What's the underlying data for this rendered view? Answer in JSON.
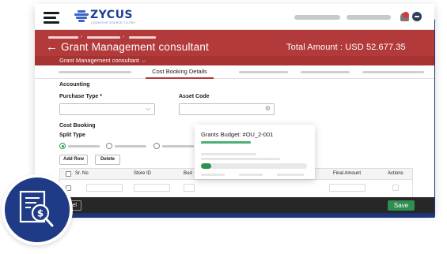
{
  "header": {
    "brand": "ZYCUS",
    "brand_tagline": "COGNITIVE SOURCE-TO-PAY"
  },
  "page": {
    "title": "Grant Management consultant",
    "total_amount": "Total Amount : USD 52.677.35",
    "subtitle": "Grant Management consultant",
    "active_tab": "Cost Booking Details"
  },
  "form": {
    "accounting_label": "Accounting",
    "purchase_type_label": "Purchase Type *",
    "purchase_type_value": "",
    "asset_code_label": "Asset Code",
    "asset_code_value": "",
    "cost_booking_label": "Cost Booking",
    "split_type_label": "Split Type",
    "add_row_label": "Add Row",
    "delete_label": "Delete"
  },
  "table": {
    "columns": [
      "Sr. No",
      "Store ID",
      "Bud",
      "Final Amount",
      "Actions"
    ]
  },
  "popup": {
    "title": "Grants Budget: #OU_2-001",
    "budget_used_fraction": 0.1
  },
  "footer": {
    "cancel_label": "cel",
    "save_label": "Save"
  },
  "colors": {
    "brand_blue": "#1f3b86",
    "header_red": "#b33a3a",
    "accent_green": "#2e8f4e"
  }
}
